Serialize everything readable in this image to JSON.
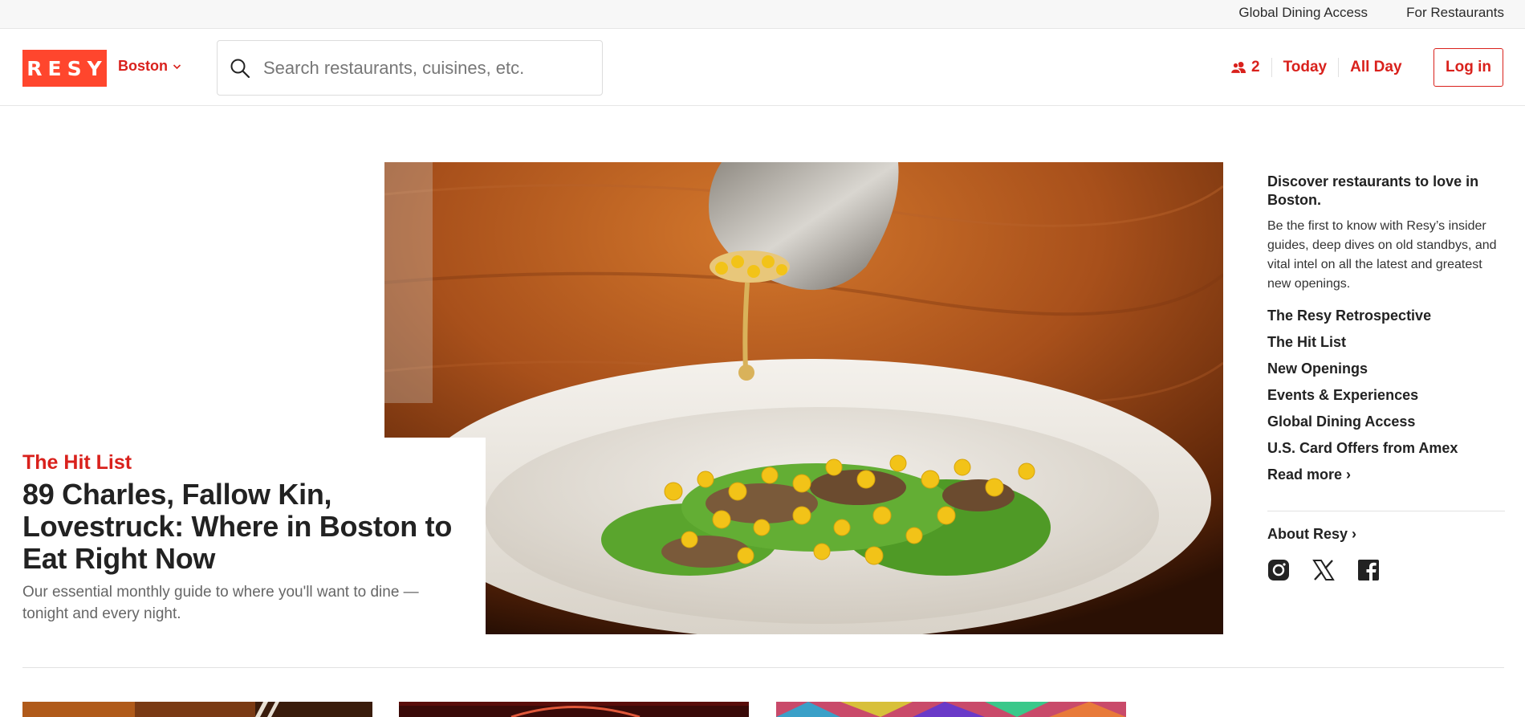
{
  "utility": {
    "global_dining": "Global Dining Access",
    "for_restaurants": "For Restaurants"
  },
  "header": {
    "logo": "RESY",
    "city": "Boston",
    "search_placeholder": "Search restaurants, cuisines, etc.",
    "party_size": "2",
    "date": "Today",
    "time": "All Day",
    "login": "Log in"
  },
  "hero": {
    "kicker": "The Hit List",
    "title": "89 Charles, Fallow Kin, Lovestruck: Where in Boston to Eat Right Now",
    "subtitle": "Our essential monthly guide to where you'll want to dine — tonight and every night."
  },
  "sidebar": {
    "heading": "Discover restaurants to love in Boston.",
    "description": "Be the first to know with Resy’s insider guides, deep dives on old standbys, and vital intel on all the latest and greatest new openings.",
    "links": [
      "The Resy Retrospective",
      "The Hit List",
      "New Openings",
      "Events & Experiences",
      "Global Dining Access",
      "U.S. Card Offers from Amex",
      "Read more ›"
    ],
    "about": "About Resy ›"
  },
  "icons": {
    "search": "search-icon",
    "chevron": "chevron-down-icon",
    "guests": "guests-icon",
    "instagram": "instagram-icon",
    "x": "x-icon",
    "facebook": "facebook-icon"
  },
  "colors": {
    "brand": "#ff462d",
    "accent": "#d9211c"
  }
}
